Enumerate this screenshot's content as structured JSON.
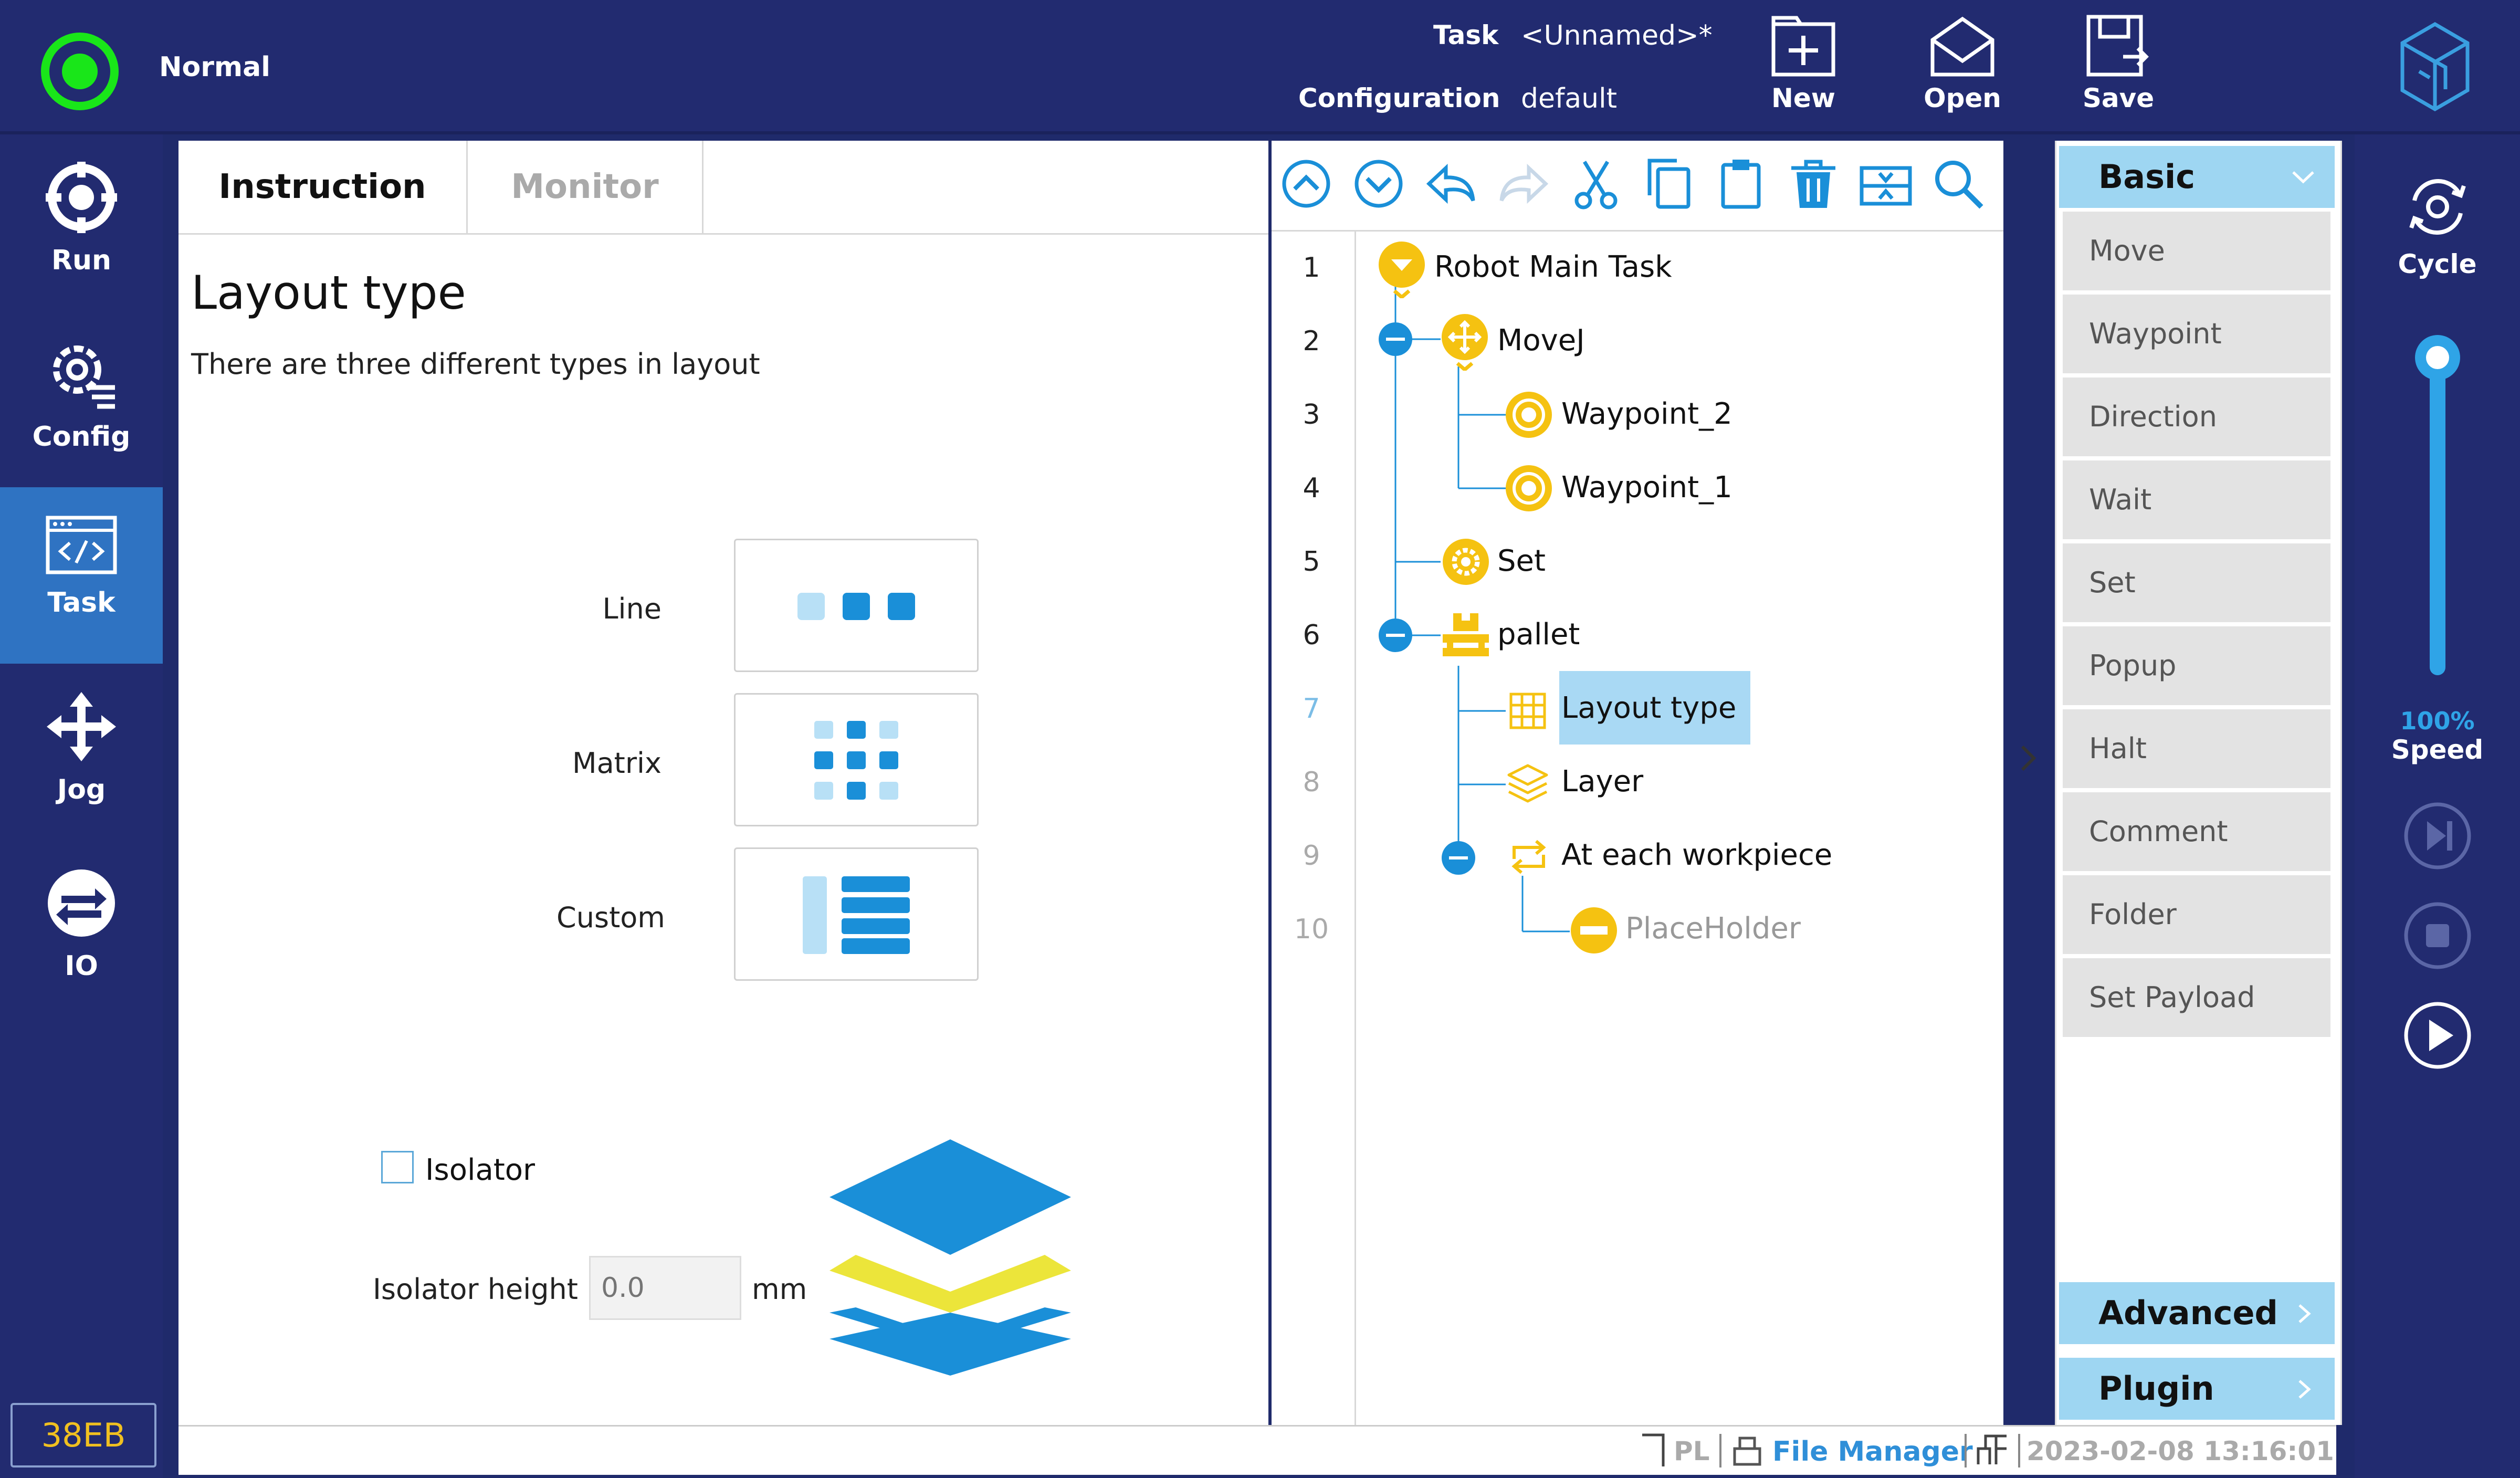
{
  "header": {
    "status_text": "Normal",
    "task_label": "Task",
    "task_value": "<Unnamed>*",
    "config_label": "Configuration",
    "config_value": "default",
    "buttons": [
      {
        "label": "New",
        "icon": "new-file-icon"
      },
      {
        "label": "Open",
        "icon": "open-envelope-icon"
      },
      {
        "label": "Save",
        "icon": "save-icon"
      }
    ],
    "logo_icon": "brand-logo-icon",
    "status_color": "#19e619"
  },
  "leftnav": {
    "items": [
      {
        "label": "Run",
        "icon": "run-icon"
      },
      {
        "label": "Config",
        "icon": "config-gear-icon"
      },
      {
        "label": "Task",
        "icon": "code-window-icon",
        "active": true
      },
      {
        "label": "Jog",
        "icon": "jog-arrows-icon"
      },
      {
        "label": "IO",
        "icon": "io-exchange-icon"
      }
    ],
    "device_id": "38EB"
  },
  "instruction_panel": {
    "tabs": [
      "Instruction",
      "Monitor"
    ],
    "active_tab": "Instruction",
    "title": "Layout type",
    "description": "There are three different types in layout",
    "options": [
      {
        "label": "Line",
        "icon": "line-layout-icon"
      },
      {
        "label": "Matrix",
        "icon": "matrix-layout-icon"
      },
      {
        "label": "Custom",
        "icon": "custom-layout-icon"
      }
    ],
    "isolator_label": "Isolator",
    "isolator_checked": false,
    "isolator_height_label": "Isolator height",
    "isolator_height_placeholder": "0.0",
    "isolator_height_unit": "mm",
    "layers_icon": "stacked-layers-icon"
  },
  "toolbar": {
    "icons": [
      "move-up-icon",
      "move-down-icon",
      "undo-icon",
      "redo-icon",
      "cut-icon",
      "copy-icon",
      "paste-icon",
      "delete-icon",
      "fold-icon",
      "search-icon"
    ]
  },
  "program_tree": {
    "rows": [
      {
        "num": "1",
        "label": "Robot Main Task",
        "icon": "main-task-icon"
      },
      {
        "num": "2",
        "label": "MoveJ",
        "icon": "move-icon"
      },
      {
        "num": "3",
        "label": "Waypoint_2",
        "icon": "waypoint-icon"
      },
      {
        "num": "4",
        "label": "Waypoint_1",
        "icon": "waypoint-icon"
      },
      {
        "num": "5",
        "label": "Set",
        "icon": "set-gear-icon"
      },
      {
        "num": "6",
        "label": "pallet",
        "icon": "pallet-icon"
      },
      {
        "num": "7",
        "label": "Layout type",
        "icon": "layout-grid-icon",
        "selected": true
      },
      {
        "num": "8",
        "label": "Layer",
        "icon": "layer-icon"
      },
      {
        "num": "9",
        "label": "At each workpiece",
        "icon": "loop-icon"
      },
      {
        "num": "10",
        "label": "PlaceHolder",
        "icon": "placeholder-icon"
      }
    ],
    "expand_icon": "chevron-right-icon"
  },
  "library": {
    "basic_label": "Basic",
    "items": [
      "Move",
      "Waypoint",
      "Direction",
      "Wait",
      "Set",
      "Popup",
      "Halt",
      "Comment",
      "Folder",
      "Set Payload"
    ],
    "advanced_label": "Advanced",
    "plugin_label": "Plugin"
  },
  "rightrail": {
    "cycle_label": "Cycle",
    "speed_percent": "100%",
    "speed_label": "Speed",
    "speed_level": 1.0
  },
  "statusbar": {
    "pl_text": "PL",
    "file_manager": "File Manager",
    "datetime": "2023-02-08 13:16:01"
  }
}
